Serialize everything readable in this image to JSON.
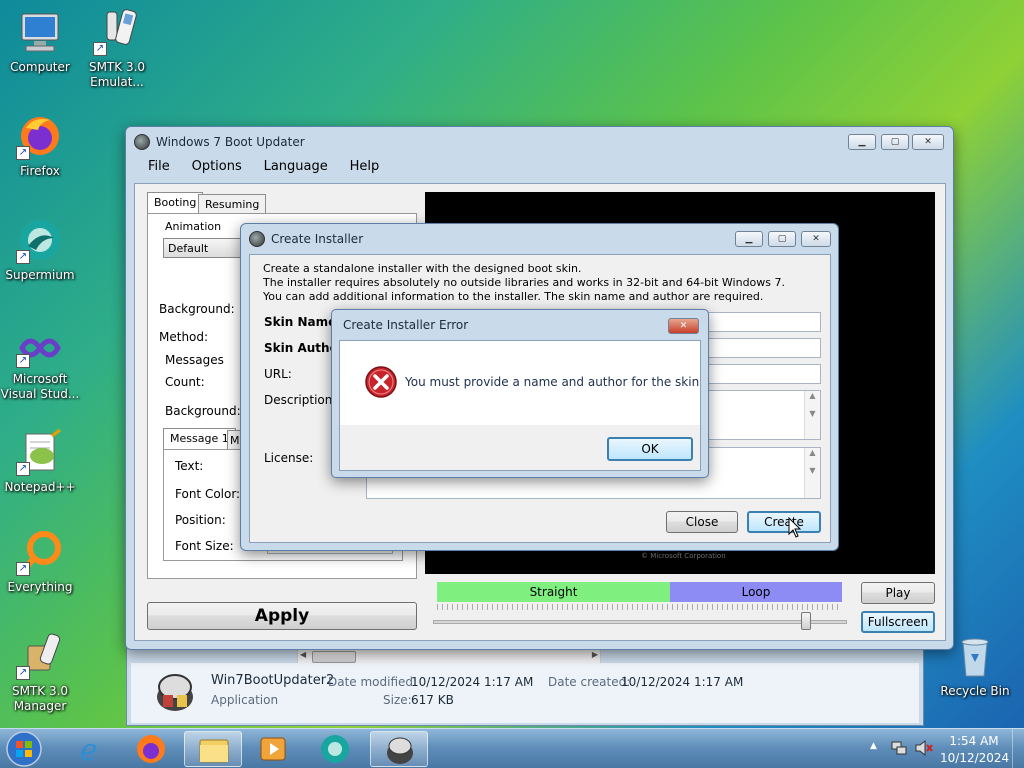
{
  "desktop": {
    "icons": [
      {
        "label": "Computer"
      },
      {
        "label": "SMTK 3.0 Emulat..."
      },
      {
        "label": "Firefox"
      },
      {
        "label": "Supermium"
      },
      {
        "label": "Microsoft Visual Stud..."
      },
      {
        "label": "Notepad++"
      },
      {
        "label": "Everything"
      },
      {
        "label": "SMTK 3.0 Manager"
      },
      {
        "label": "Recycle Bin"
      }
    ]
  },
  "main_window": {
    "title": "Windows 7 Boot Updater",
    "menu": [
      "File",
      "Options",
      "Language",
      "Help"
    ],
    "tabs": [
      "Booting",
      "Resuming"
    ],
    "animation_label": "Animation",
    "animation_value": "Default",
    "background_label": "Background:",
    "method_label": "Method:",
    "messages_label": "Messages",
    "count_label": "Count:",
    "msg_background_label": "Background:",
    "message_tabs": [
      "Message 1",
      "M"
    ],
    "text_label": "Text:",
    "font_color_label": "Font Color:",
    "position_label": "Position:",
    "font_size_label": "Font Size:",
    "apply_label": "Apply",
    "preview_caption": "© Microsoft Corporation",
    "straight_label": "Straight",
    "loop_label": "Loop",
    "play_label": "Play",
    "fullscreen_label": "Fullscreen",
    "slider_level": 0.97
  },
  "create_installer": {
    "title": "Create Installer",
    "desc1": "Create a standalone installer with the designed boot skin.",
    "desc2": "The installer requires absolutely no outside libraries and works in 32-bit and 64-bit Windows 7.",
    "desc3": "You can add additional information to the installer. The skin name and author are required.",
    "skin_name_label": "Skin Name:",
    "skin_author_label": "Skin Author",
    "url_label": "URL:",
    "description_label": "Description:",
    "license_label": "License:",
    "close_label": "Close",
    "create_label": "Create"
  },
  "error_dialog": {
    "title": "Create Installer Error",
    "message": "You must provide a name and author for the skin",
    "ok_label": "OK"
  },
  "explorer": {
    "file_name": "Win7BootUpdater2",
    "file_type": "Application",
    "date_modified_label": "Date modified:",
    "date_modified": "10/12/2024 1:17 AM",
    "date_created_label": "Date created:",
    "date_created": "10/12/2024 1:17 AM",
    "size_label": "Size:",
    "size": "617 KB"
  },
  "taskbar": {
    "time": "1:54 AM",
    "date": "10/12/2024"
  },
  "colors": {
    "straight": "#7ff07f",
    "loop": "#8c8cf4",
    "error_icon": "#c8242b"
  }
}
